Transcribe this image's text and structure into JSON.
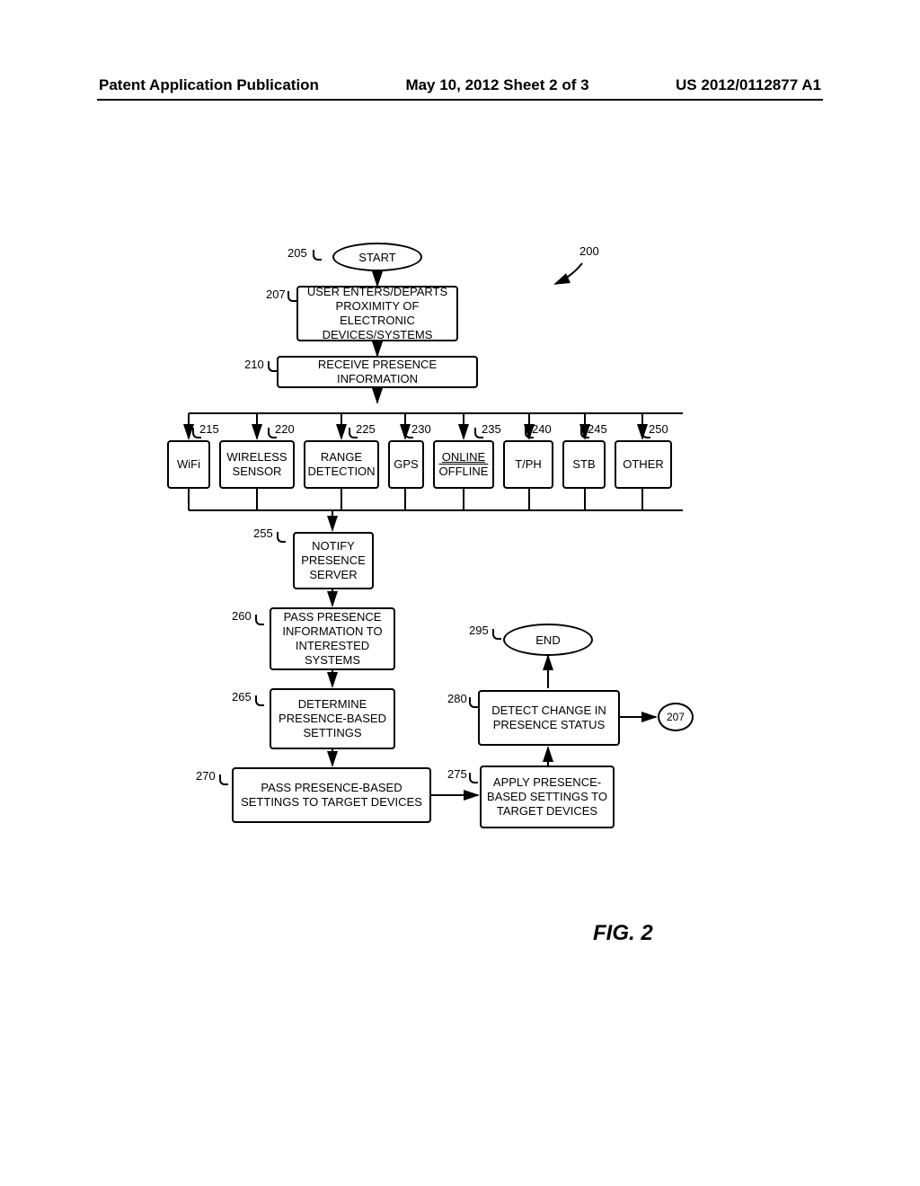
{
  "header": {
    "left": "Patent Application Publication",
    "center": "May 10, 2012  Sheet 2 of 3",
    "right": "US 2012/0112877 A1"
  },
  "figure_label": "FIG. 2",
  "overall_ref": "200",
  "nodes": {
    "start": {
      "ref": "205",
      "label": "START"
    },
    "n207": {
      "ref": "207",
      "label": "USER ENTERS/DEPARTS PROXIMITY OF ELECTRONIC DEVICES/SYSTEMS"
    },
    "n210": {
      "ref": "210",
      "label": "RECEIVE PRESENCE INFORMATION"
    },
    "n215": {
      "ref": "215",
      "label": "WiFi"
    },
    "n220": {
      "ref": "220",
      "label": "WIRELESS SENSOR"
    },
    "n225": {
      "ref": "225",
      "label": "RANGE DETECTION"
    },
    "n230": {
      "ref": "230",
      "label": "GPS"
    },
    "n235": {
      "ref": "235",
      "label_online": "ONLINE",
      "label_offline": "OFFLINE"
    },
    "n240": {
      "ref": "240",
      "label": "T/PH"
    },
    "n245": {
      "ref": "245",
      "label": "STB"
    },
    "n250": {
      "ref": "250",
      "label": "OTHER"
    },
    "n255": {
      "ref": "255",
      "label": "NOTIFY PRESENCE SERVER"
    },
    "n260": {
      "ref": "260",
      "label": "PASS PRESENCE INFORMATION TO INTERESTED SYSTEMS"
    },
    "n265": {
      "ref": "265",
      "label": "DETERMINE PRESENCE-BASED SETTINGS"
    },
    "n270": {
      "ref": "270",
      "label": "PASS PRESENCE-BASED SETTINGS TO TARGET DEVICES"
    },
    "n275": {
      "ref": "275",
      "label": "APPLY PRESENCE-BASED SETTINGS TO TARGET DEVICES"
    },
    "n280": {
      "ref": "280",
      "label": "DETECT CHANGE IN PRESENCE STATUS"
    },
    "end": {
      "ref": "295",
      "label": "END"
    },
    "loopref": {
      "label": "207"
    }
  }
}
